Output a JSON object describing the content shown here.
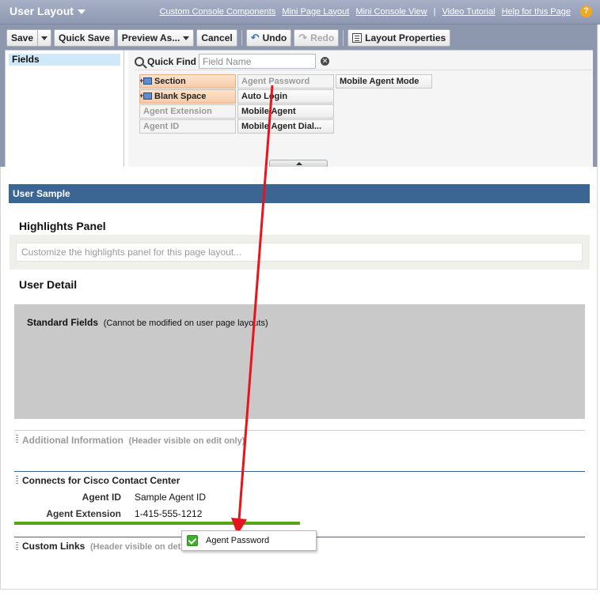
{
  "header": {
    "title": "User Layout",
    "links": [
      "Custom Console Components",
      "Mini Page Layout",
      "Mini Console View",
      "|",
      "Video Tutorial",
      "Help for this Page"
    ],
    "help_icon": "?"
  },
  "toolbar": {
    "save": "Save",
    "quick_save": "Quick Save",
    "preview_as": "Preview As...",
    "cancel": "Cancel",
    "undo": "Undo",
    "redo": "Redo",
    "layout_properties": "Layout Properties"
  },
  "palette": {
    "category": "Fields",
    "quick_find_label": "Quick Find",
    "quick_find_placeholder": "Field Name",
    "fields": [
      {
        "label": "Section",
        "state": "special"
      },
      {
        "label": "Agent Password",
        "state": "used"
      },
      {
        "label": "Mobile Agent Mode",
        "state": "available"
      },
      {
        "label": "Blank Space",
        "state": "special"
      },
      {
        "label": "Auto Login",
        "state": "available"
      },
      {
        "label": "Agent Extension",
        "state": "used"
      },
      {
        "label": "Mobile Agent",
        "state": "available"
      },
      {
        "label": "Agent ID",
        "state": "used"
      },
      {
        "label": "Mobile Agent Dial...",
        "state": "available"
      }
    ]
  },
  "layout": {
    "sample_title": "User Sample",
    "highlights_title": "Highlights Panel",
    "highlights_placeholder": "Customize the highlights panel for this page layout...",
    "user_detail_title": "User Detail",
    "standard_fields_label": "Standard Fields",
    "standard_fields_note": "(Cannot be modified on user page layouts)",
    "additional_info_title": "Additional Information",
    "additional_info_hint": "(Header visible on edit only)",
    "cisco_section_title": "Connects for Cisco Contact Center",
    "cisco_fields": [
      {
        "label": "Agent ID",
        "value": "Sample Agent ID"
      },
      {
        "label": "Agent Extension",
        "value": "1-415-555-1212"
      }
    ],
    "custom_links_title": "Custom Links",
    "custom_links_hint": "(Header visible on det"
  },
  "drag_ghost": {
    "label": "Agent Password"
  },
  "colors": {
    "header_bg": "#8e99b3",
    "section_bar": "#3b6592",
    "drop_indicator": "#55a514",
    "arrow": "#e8141b"
  }
}
